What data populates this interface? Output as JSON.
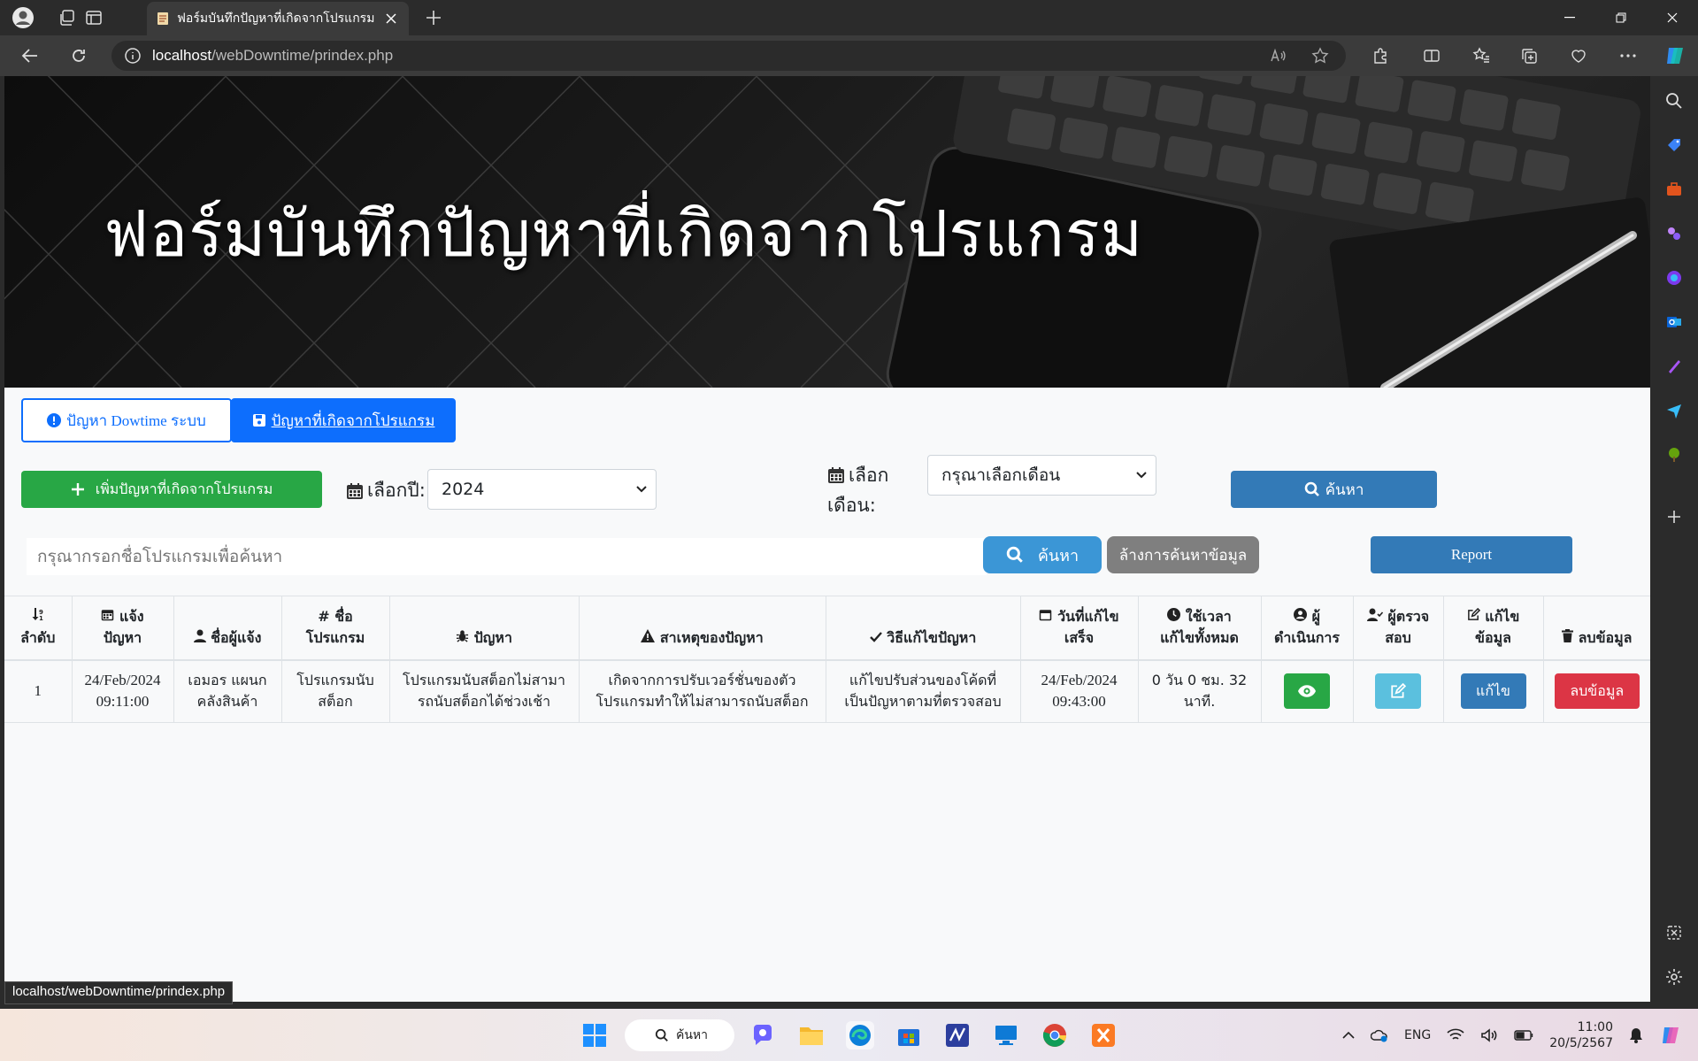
{
  "browser": {
    "tab_title": "ฟอร์มบันทึกปัญหาที่เกิดจากโปรแกรม",
    "url_host": "localhost",
    "url_path": "/webDowntime/prindex.php",
    "status_url": "localhost/webDowntime/prindex.php"
  },
  "page": {
    "banner_title": "ฟอร์มบันทึกปัญหาที่เกิดจากโปรแกรม",
    "tabs": [
      {
        "label": "ปัญหา Dowtime ระบบ"
      },
      {
        "label": "ปัญหาที่เกิดจากโปรแกรม"
      }
    ],
    "add_button": "เพิ่มปัญหาที่เกิดจากโปรแกรม",
    "year_label": "เลือกปี:",
    "year_value": "2024",
    "month_label_1": "เลือก",
    "month_label_2": "เดือน:",
    "month_value": "กรุณาเลือกเดือน",
    "search_top": "ค้นหา",
    "search_placeholder": "กรุณากรอกชื่อโปรแกรมเพื่อค้นหา",
    "search_button": "ค้นหา",
    "clear_button": "ล้างการค้นหาข้อมูล",
    "report_button": "Report"
  },
  "table": {
    "headers": [
      [
        "ลำดับ"
      ],
      [
        "แจ้ง",
        "ปัญหา"
      ],
      [
        "ชื่อผู้แจ้ง"
      ],
      [
        "ชื่อ",
        "โปรแกรม"
      ],
      [
        "ปัญหา"
      ],
      [
        "สาเหตุของปัญหา"
      ],
      [
        "วิธีแก้ไขปัญหา"
      ],
      [
        "วันที่แก้ไข",
        "เสร็จ"
      ],
      [
        "ใช้เวลา",
        "แก้ไขทั้งหมด"
      ],
      [
        "ผู้",
        "ดำเนินการ"
      ],
      [
        "ผู้ตรวจ",
        "สอบ"
      ],
      [
        "แก้ไข",
        "ข้อมูล"
      ],
      [
        "ลบข้อมูล"
      ]
    ],
    "rows": [
      {
        "no": "1",
        "date1": "24/Feb/2024",
        "time1": "09:11:00",
        "reporter1": "เอมอร แผนก",
        "reporter2": "คลังสินค้า",
        "program1": "โปรแกรมนับ",
        "program2": "สต็อก",
        "problem1": "โปรแกรมนับสต็อกไม่สามา",
        "problem2": "รถนับสต็อกได้ช่วงเช้า",
        "cause1": "เกิดจากการปรับเวอร์ชั่นของตัว",
        "cause2": "โปรแกรมทำให้ไม่สามารถนับสต็อก",
        "fix1": "แก้ไขปรับส่วนของโค้ดที่",
        "fix2": "เป็นปัญหาตามที่ตรวจสอบ",
        "date2": "24/Feb/2024",
        "time2": "09:43:00",
        "duration1": "0 วัน 0 ชม. 32",
        "duration2": "นาที.",
        "edit_label": "แก้ไข",
        "delete_label": "ลบข้อมูล"
      }
    ]
  },
  "taskbar": {
    "search": "ค้นหา",
    "lang": "ENG",
    "time": "11:00",
    "date": "20/5/2567"
  }
}
